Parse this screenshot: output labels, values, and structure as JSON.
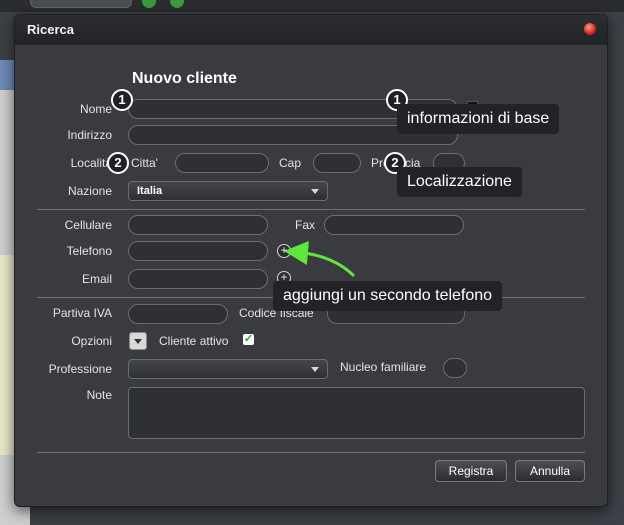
{
  "dialog": {
    "title": "Ricerca",
    "heading": "Nuovo cliente"
  },
  "form": {
    "nome_label": "Nome",
    "indirizzo_label": "Indirizzo",
    "localita_label": "Località",
    "citta_label": "Citta'",
    "cap_label": "Cap",
    "provincia_label": "Provincia",
    "nazione_label": "Nazione",
    "nazione_value": "Italia",
    "cellulare_label": "Cellulare",
    "fax_label": "Fax",
    "telefono_label": "Telefono",
    "email_label": "Email",
    "partiva_label": "Partiva IVA",
    "codice_fiscale_label": "Codice fiscale",
    "opzioni_label": "Opzioni",
    "cliente_attivo_label": "Cliente attivo",
    "cliente_attivo_checked": true,
    "professione_label": "Professione",
    "professione_value": "",
    "nucleo_label": "Nucleo familiare",
    "note_label": "Note"
  },
  "annotations": {
    "badge1": "1",
    "badge2": "2",
    "callout_base": "informazioni di base",
    "callout_loc": "Localizzazione",
    "callout_phone": "aggiungi un secondo telefono",
    "arrow_color": "#5ee83a"
  },
  "buttons": {
    "registra": "Registra",
    "annulla": "Annulla"
  },
  "icons": {
    "close": "close-icon",
    "add_phone": "plus-icon",
    "add_email": "plus-icon",
    "check": "checkmark-icon",
    "dropdown": "chevron-down-icon"
  },
  "colors": {
    "dialog_bg": "#393b40",
    "callout_bg": "#222327",
    "checkbox_check": "#2ea52e"
  }
}
